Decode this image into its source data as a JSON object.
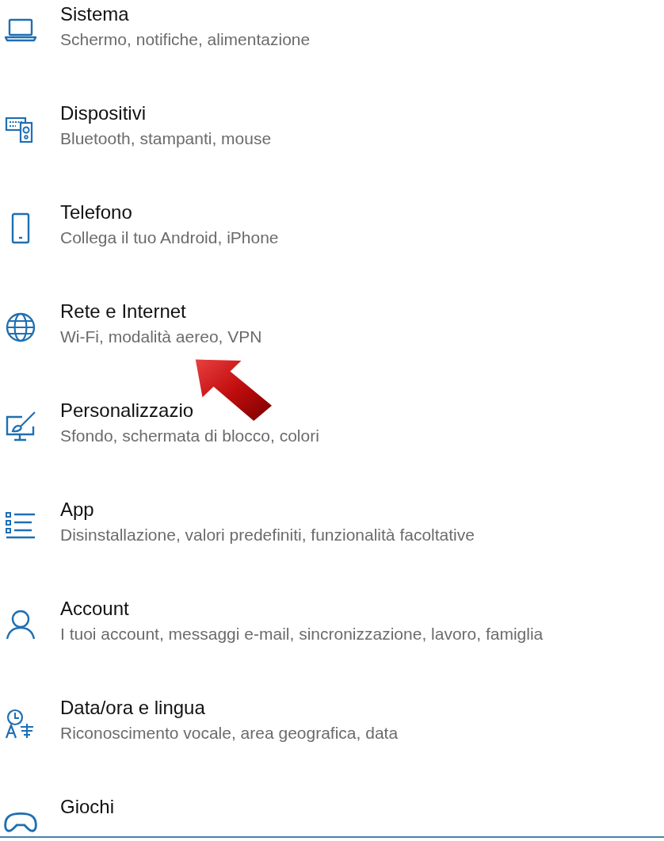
{
  "settings_items": [
    {
      "title": "Sistema",
      "subtitle": "Schermo, notifiche, alimentazione"
    },
    {
      "title": "Dispositivi",
      "subtitle": "Bluetooth, stampanti, mouse"
    },
    {
      "title": "Telefono",
      "subtitle": "Collega il tuo Android, iPhone"
    },
    {
      "title": "Rete e Internet",
      "subtitle": "Wi-Fi, modalità aereo, VPN"
    },
    {
      "title": "Personalizzazio",
      "subtitle": "Sfondo, schermata di blocco, colori"
    },
    {
      "title": "App",
      "subtitle": "Disinstallazione, valori predefiniti, funzionalità facoltative"
    },
    {
      "title": "Account",
      "subtitle": "I tuoi account, messaggi e-mail, sincronizzazione, lavoro, famiglia"
    },
    {
      "title": "Data/ora e lingua",
      "subtitle": "Riconoscimento vocale, area geografica, data"
    },
    {
      "title": "Giochi"
    }
  ]
}
